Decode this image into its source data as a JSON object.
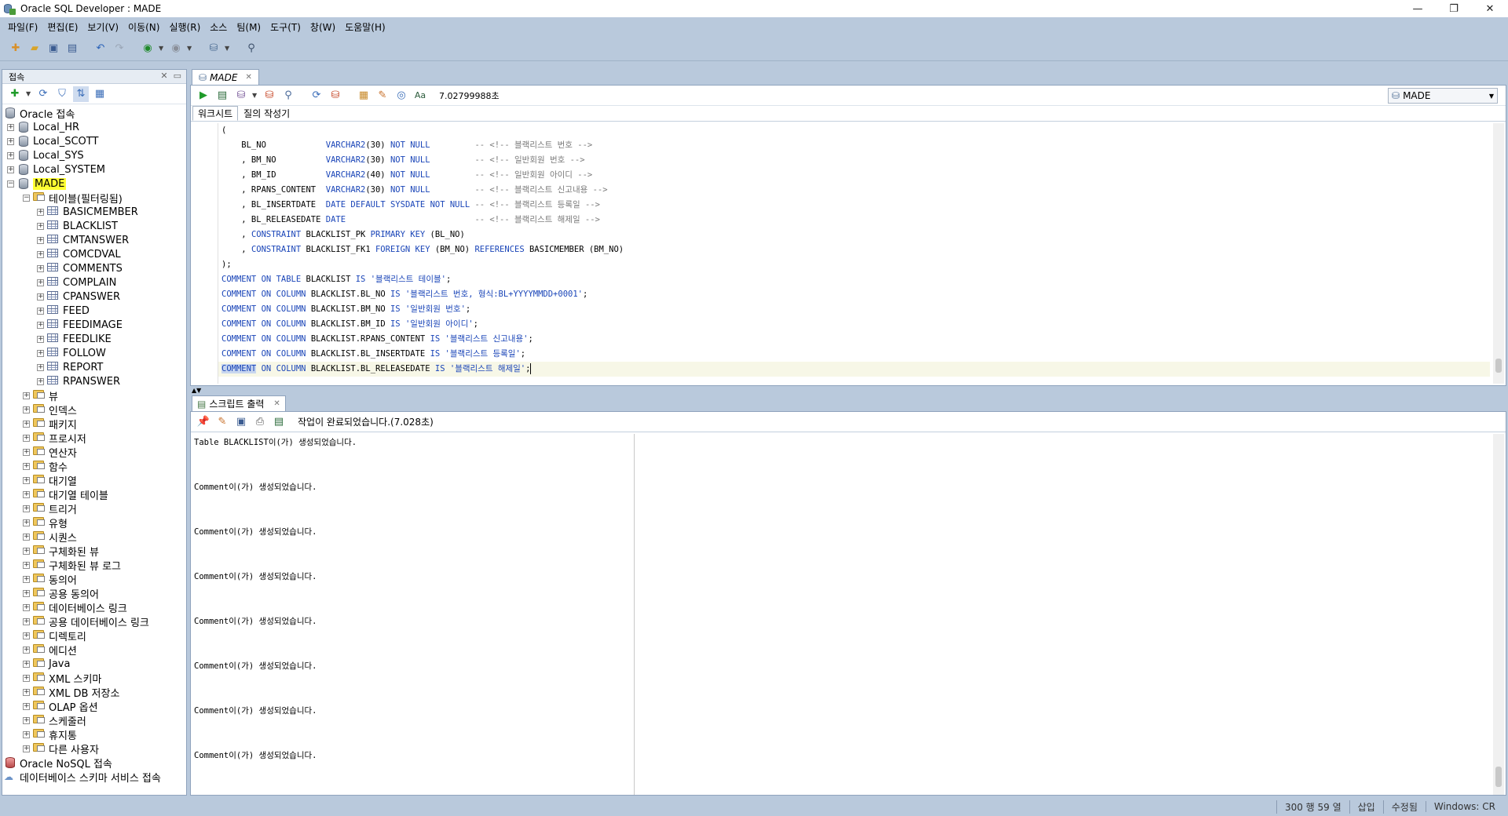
{
  "window": {
    "title": "Oracle SQL Developer : MADE",
    "min": "—",
    "max": "❐",
    "close": "✕"
  },
  "menu": [
    "파일(F)",
    "편집(E)",
    "보기(V)",
    "이동(N)",
    "실행(R)",
    "소스",
    "팀(M)",
    "도구(T)",
    "창(W)",
    "도움말(H)"
  ],
  "connections_panel": {
    "tab_label": "접속",
    "tree": {
      "root": "Oracle 접속",
      "connections": [
        "Local_HR",
        "Local_SCOTT",
        "Local_SYS",
        "Local_SYSTEM"
      ],
      "active_connection": "MADE",
      "tables_folder": "테이블(필터링됨)",
      "tables": [
        "BASICMEMBER",
        "BLACKLIST",
        "CMTANSWER",
        "COMCDVAL",
        "COMMENTS",
        "COMPLAIN",
        "CPANSWER",
        "FEED",
        "FEEDIMAGE",
        "FEEDLIKE",
        "FOLLOW",
        "REPORT",
        "RPANSWER"
      ],
      "folders": [
        "뷰",
        "인덱스",
        "패키지",
        "프로시저",
        "연산자",
        "함수",
        "대기열",
        "대기열 테이블",
        "트리거",
        "유형",
        "시퀀스",
        "구체화된 뷰",
        "구체화된 뷰 로그",
        "동의어",
        "공용 동의어",
        "데이터베이스 링크",
        "공용 데이터베이스 링크",
        "디렉토리",
        "에디션",
        "Java",
        "XML 스키마",
        "XML DB 저장소",
        "OLAP 옵션",
        "스케줄러",
        "휴지통",
        "다른 사용자"
      ],
      "nosql": "Oracle NoSQL 접속",
      "schema_service": "데이터베이스 스키마 서비스 접속"
    }
  },
  "editor": {
    "tab_label": "MADE",
    "elapsed": "7.02799988초",
    "connection": "MADE",
    "subtabs": [
      "워크시트",
      "질의 작성기"
    ],
    "code_lines": [
      {
        "t": "("
      },
      {
        "t": "    BL_NO            VARCHAR2(30) NOT NULL         -- <!-- 블랙리스트 번호 -->"
      },
      {
        "t": "    , BM_NO          VARCHAR2(30) NOT NULL         -- <!-- 일반회원 번호 -->"
      },
      {
        "t": "    , BM_ID          VARCHAR2(40) NOT NULL         -- <!-- 일반회원 아이디 -->"
      },
      {
        "t": "    , RPANS_CONTENT  VARCHAR2(30) NOT NULL         -- <!-- 블랙리스트 신고내용 -->"
      },
      {
        "t": "    , BL_INSERTDATE  DATE DEFAULT SYSDATE NOT NULL -- <!-- 블랙리스트 등록일 -->"
      },
      {
        "t": "    , BL_RELEASEDATE DATE                          -- <!-- 블랙리스트 해제일 -->"
      },
      {
        "t": "    , CONSTRAINT BLACKLIST_PK PRIMARY KEY (BL_NO)"
      },
      {
        "t": "    , CONSTRAINT BLACKLIST_FK1 FOREIGN KEY (BM_NO) REFERENCES BASICMEMBER (BM_NO)"
      },
      {
        "t": ");"
      },
      {
        "t": "COMMENT ON TABLE BLACKLIST IS '블랙리스트 테이블';"
      },
      {
        "t": "COMMENT ON COLUMN BLACKLIST.BL_NO IS '블랙리스트 번호, 형식:BL+YYYYMMDD+0001';"
      },
      {
        "t": "COMMENT ON COLUMN BLACKLIST.BM_NO IS '일반회원 번호';"
      },
      {
        "t": "COMMENT ON COLUMN BLACKLIST.BM_ID IS '일반회원 아이디';"
      },
      {
        "t": "COMMENT ON COLUMN BLACKLIST.RPANS_CONTENT IS '블랙리스트 신고내용';"
      },
      {
        "t": "COMMENT ON COLUMN BLACKLIST.BL_INSERTDATE IS '블랙리스트 등록일';"
      },
      {
        "t": "COMMENT ON COLUMN BLACKLIST.BL_RELEASEDATE IS '블랙리스트 해제일';"
      }
    ]
  },
  "script_output": {
    "tab_label": "스크립트 출력",
    "status": "작업이 완료되었습니다.(7.028초)",
    "lines": [
      "Table BLACKLIST이(가) 생성되었습니다.",
      "Comment이(가) 생성되었습니다.",
      "Comment이(가) 생성되었습니다.",
      "Comment이(가) 생성되었습니다.",
      "Comment이(가) 생성되었습니다.",
      "Comment이(가) 생성되었습니다.",
      "Comment이(가) 생성되었습니다.",
      "Comment이(가) 생성되었습니다."
    ]
  },
  "statusbar": {
    "position": "300 행 59 열",
    "mode": "삽입",
    "modified": "수정됨",
    "eol": "Windows: CR"
  },
  "colors": {
    "chrome": "#b9c9dc",
    "keyword": "#1a45b8",
    "comment": "#7a7a7a",
    "highlight": "#ffff33"
  }
}
